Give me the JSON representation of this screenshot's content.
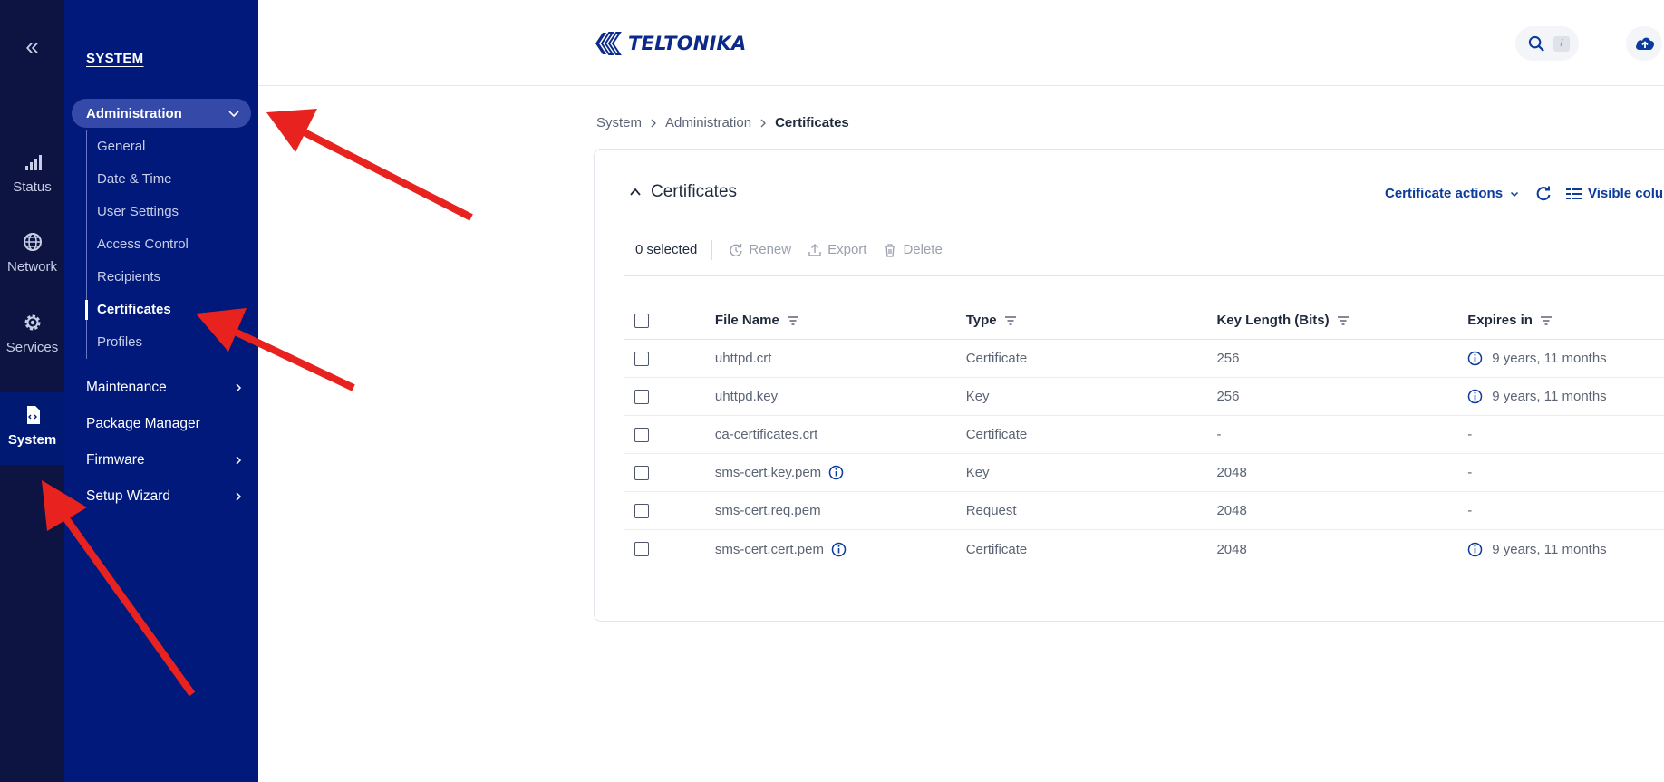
{
  "rail": {
    "collapse_glyph": "«",
    "items": [
      {
        "label": "Status",
        "icon": "signal-bars-icon"
      },
      {
        "label": "Network",
        "icon": "globe-icon"
      },
      {
        "label": "Services",
        "icon": "gear-icon"
      },
      {
        "label": "System",
        "icon": "file-code-icon"
      }
    ]
  },
  "sidebar": {
    "section": "SYSTEM",
    "expanded": {
      "label": "Administration",
      "children": [
        "General",
        "Date & Time",
        "User Settings",
        "Access Control",
        "Recipients",
        "Certificates",
        "Profiles"
      ],
      "active": "Certificates"
    },
    "items": [
      "Maintenance",
      "Package Manager",
      "Firmware",
      "Setup Wizard"
    ]
  },
  "header": {
    "logo_text": "TELTONIKA",
    "search_shortcut": "/"
  },
  "breadcrumb": [
    "System",
    "Administration",
    "Certificates"
  ],
  "card": {
    "title": "Certificates",
    "actions_label": "Certificate actions",
    "visible_columns_label": "Visible colum"
  },
  "toolbar": {
    "selected": "0 selected",
    "renew": "Renew",
    "export": "Export",
    "delete": "Delete"
  },
  "table": {
    "columns": [
      "File Name",
      "Type",
      "Key Length (Bits)",
      "Expires in"
    ],
    "rows": [
      {
        "file": "uhttpd.crt",
        "type": "Certificate",
        "key": "256",
        "expires": "9 years, 11 months"
      },
      {
        "file": "uhttpd.key",
        "type": "Key",
        "key": "256",
        "expires": "9 years, 11 months"
      },
      {
        "file": "ca-certificates.crt",
        "type": "Certificate",
        "key": "-",
        "expires": "-"
      },
      {
        "file": "sms-cert.key.pem",
        "type": "Key",
        "key": "2048",
        "expires": "-"
      },
      {
        "file": "sms-cert.req.pem",
        "type": "Request",
        "key": "2048",
        "expires": "-"
      },
      {
        "file": "sms-cert.cert.pem",
        "type": "Certificate",
        "key": "2048",
        "expires": "9 years, 11 months"
      }
    ]
  },
  "colors": {
    "rail_bg": "#0d1442",
    "sidebar_bg": "#00197a",
    "accent": "#0b3b9c",
    "annotation": "#e8231f"
  }
}
